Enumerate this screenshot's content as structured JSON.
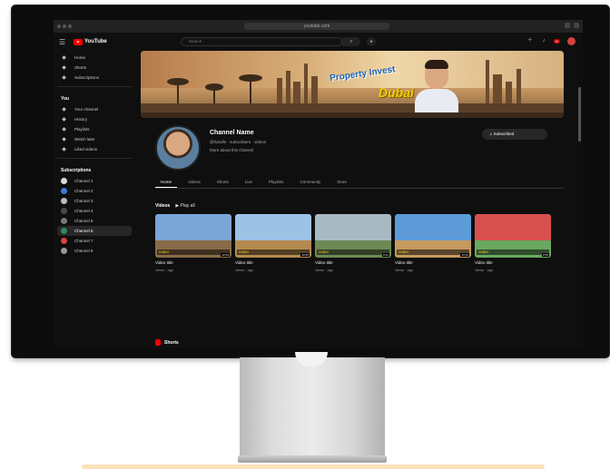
{
  "browser": {
    "url": "youtube.com"
  },
  "youtube": {
    "logo_text": "YouTube",
    "search_placeholder": "Search",
    "notification_count": "9+"
  },
  "sidebar": {
    "primary": [
      {
        "label": "Home",
        "icon": "home-icon"
      },
      {
        "label": "Shorts",
        "icon": "shorts-icon"
      },
      {
        "label": "Subscriptions",
        "icon": "subscriptions-icon"
      }
    ],
    "you_header": "You",
    "you_items": [
      {
        "label": "Your channel",
        "icon": "person-icon"
      },
      {
        "label": "History",
        "icon": "history-icon"
      },
      {
        "label": "Playlists",
        "icon": "playlist-icon"
      },
      {
        "label": "Watch later",
        "icon": "clock-icon"
      },
      {
        "label": "Liked videos",
        "icon": "like-icon"
      }
    ],
    "subs_header": "Subscriptions",
    "subs_items": [
      {
        "label": "Channel 1",
        "color": "#d9d9d9"
      },
      {
        "label": "Channel 2",
        "color": "#3a7bd5"
      },
      {
        "label": "Channel 3",
        "color": "#bbbbbb"
      },
      {
        "label": "Channel 4",
        "color": "#4a4a4a"
      },
      {
        "label": "Channel 5",
        "color": "#777777"
      },
      {
        "label": "Channel 6",
        "color": "#2c8a5a",
        "active": true
      },
      {
        "label": "Channel 7",
        "color": "#d2433c"
      },
      {
        "label": "Channel 8",
        "color": "#999999"
      }
    ]
  },
  "banner": {
    "title": "Property Invest",
    "highlight": "Dubai"
  },
  "channel": {
    "name": "Channel Name",
    "meta": "@handle · subscribers · videos",
    "description": "More about this channel",
    "subscribe_label": "Subscribed"
  },
  "tabs": [
    "Home",
    "Videos",
    "Shorts",
    "Live",
    "Playlists",
    "Community",
    "Store"
  ],
  "videos_section": {
    "title": "Videos",
    "play_all": "▶ Play all"
  },
  "videos": [
    {
      "title": "Video title",
      "meta": "views · ago",
      "caption": "DUBAI",
      "duration": "12:03",
      "sky": "#7aa6d6",
      "ground": "#8a6b47"
    },
    {
      "title": "Video title",
      "meta": "views · ago",
      "caption": "DUBAI",
      "duration": "10:45",
      "sky": "#9cc3e6",
      "ground": "#b48b4f"
    },
    {
      "title": "Video title",
      "meta": "views · ago",
      "caption": "DUBAI",
      "duration": "9:21",
      "sky": "#a8b9c4",
      "ground": "#6d8a55"
    },
    {
      "title": "Video title",
      "meta": "views · ago",
      "caption": "DUBAI",
      "duration": "14:10",
      "sky": "#5c9bd8",
      "ground": "#c59a5f"
    },
    {
      "title": "Video title",
      "meta": "views · ago",
      "caption": "DUBAI",
      "duration": "8:55",
      "sky": "#d85050",
      "ground": "#6aa860"
    }
  ],
  "shorts_section": {
    "title": "Shorts"
  }
}
